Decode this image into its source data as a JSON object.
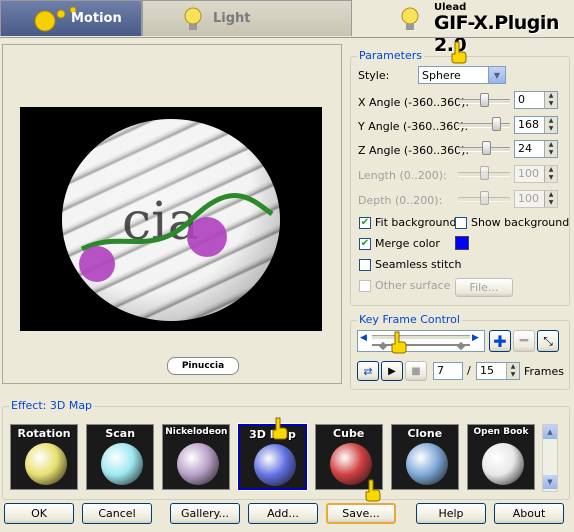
{
  "tabs": {
    "motion": "Motion",
    "light": "Light",
    "brand_small": "Ulead",
    "brand_big": "GIF-X.Plugin 2.0"
  },
  "preview": {
    "signature": "Pinuccia"
  },
  "parameters": {
    "legend": "Parameters",
    "style_label": "Style:",
    "style_value": "Sphere",
    "x_angle_label": "X Angle (-360..360):",
    "x_angle_value": "0",
    "x_angle_level": 0.5,
    "y_angle_label": "Y Angle (-360..360):",
    "y_angle_value": "168",
    "y_angle_level": 0.73,
    "z_angle_label": "Z Angle (-360..360):",
    "z_angle_value": "24",
    "z_angle_level": 0.53,
    "length_label": "Length (0..200):",
    "length_value": "100",
    "depth_label": "Depth (0..200):",
    "depth_value": "100",
    "fit_background": "Fit background",
    "fit_background_checked": true,
    "show_background": "Show background",
    "show_background_checked": false,
    "merge_color": "Merge color",
    "merge_color_checked": true,
    "merge_color_swatch": "#0000ff",
    "seamless_stitch": "Seamless stitch",
    "seamless_stitch_checked": false,
    "other_surface": "Other surface",
    "file_button": "File..."
  },
  "keyframe": {
    "legend": "Key Frame Control",
    "current_frame": "7",
    "separator": "/",
    "total_frames": "15",
    "frames_label": "Frames"
  },
  "effect": {
    "legend": "Effect: 3D Map",
    "items": [
      {
        "label": "Rotation",
        "color": "#e8e070"
      },
      {
        "label": "Scan",
        "color": "#9ee8f0"
      },
      {
        "label": "Nickelodeon",
        "color": "#b8a0c8"
      },
      {
        "label": "3D Map",
        "color": "#6070e0",
        "selected": true
      },
      {
        "label": "Cube",
        "color": "#d04040"
      },
      {
        "label": "Clone",
        "color": "#80a8d8"
      },
      {
        "label": "Open Book",
        "color": "#e8e8e8"
      }
    ]
  },
  "buttons": {
    "ok": "OK",
    "cancel": "Cancel",
    "gallery": "Gallery...",
    "add": "Add...",
    "save": "Save...",
    "help": "Help",
    "about": "About"
  }
}
